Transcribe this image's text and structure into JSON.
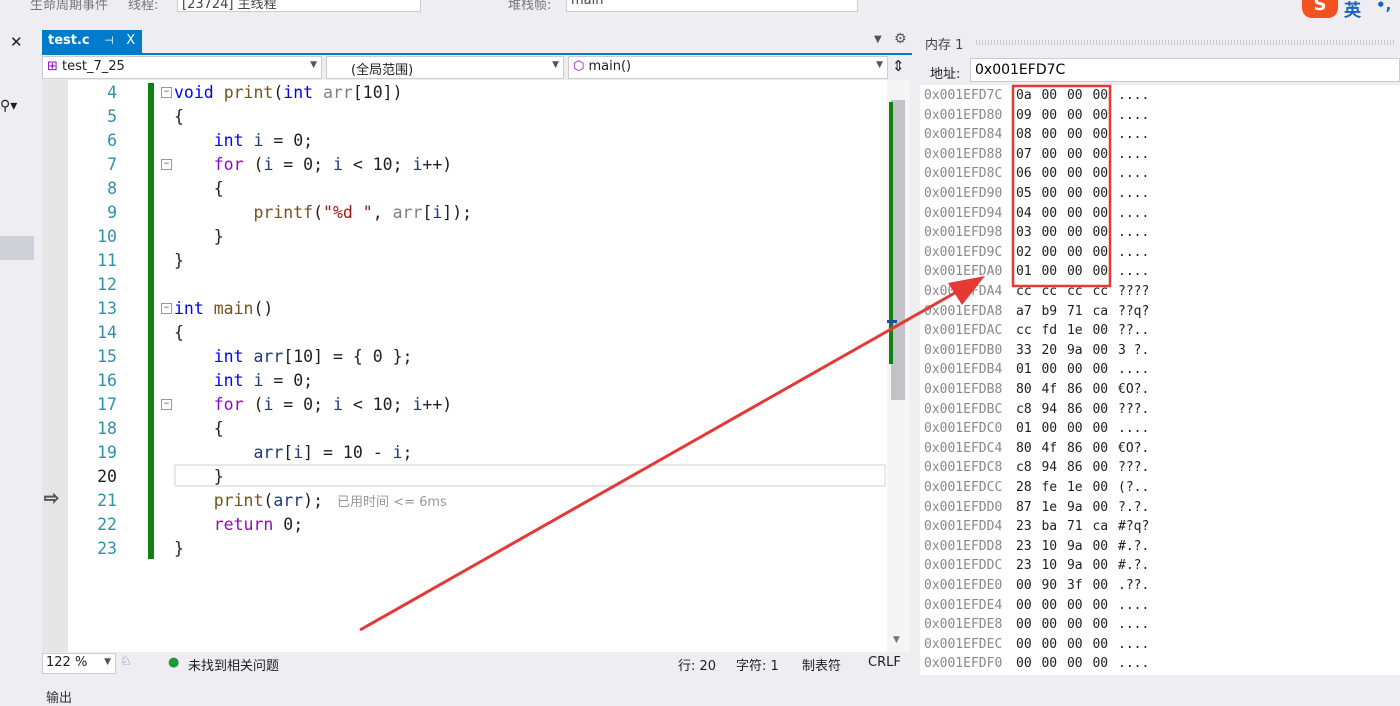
{
  "toolbar": {
    "lifecycle": "生命周期事件",
    "thread_label": "线程:",
    "thread_value": "[23724] 主线程",
    "stack_label": "堆栈帧:",
    "stack_value": "main"
  },
  "ime": {
    "mode": "英",
    "punct": "•,"
  },
  "editor": {
    "tab": {
      "name": "test.c",
      "pin": "⊣",
      "close": "X"
    },
    "nav": {
      "project": "test_7_25",
      "scope": "(全局范围)",
      "member": "main()"
    },
    "lines": [
      {
        "n": "4",
        "t": [
          [
            "void",
            "kw"
          ],
          [
            " ",
            "pl"
          ],
          [
            "print",
            "fn"
          ],
          [
            "(",
            "pl"
          ],
          [
            "int",
            "kw"
          ],
          [
            " ",
            "pl"
          ],
          [
            "arr",
            "var"
          ],
          [
            "[10])",
            "pl"
          ]
        ]
      },
      {
        "n": "5",
        "t": [
          [
            "{",
            "pl"
          ]
        ]
      },
      {
        "n": "6",
        "t": [
          [
            "    ",
            "pl"
          ],
          [
            "int",
            "kw"
          ],
          [
            " ",
            "pl"
          ],
          [
            "i",
            "loc"
          ],
          [
            " = 0;",
            "pl"
          ]
        ]
      },
      {
        "n": "7",
        "t": [
          [
            "    ",
            "pl"
          ],
          [
            "for",
            "ctl"
          ],
          [
            " (",
            "pl"
          ],
          [
            "i",
            "loc"
          ],
          [
            " = 0; ",
            "pl"
          ],
          [
            "i",
            "loc"
          ],
          [
            " < 10; ",
            "pl"
          ],
          [
            "i",
            "loc"
          ],
          [
            "++)",
            "pl"
          ]
        ]
      },
      {
        "n": "8",
        "t": [
          [
            "    {",
            "pl"
          ]
        ]
      },
      {
        "n": "9",
        "t": [
          [
            "        ",
            "pl"
          ],
          [
            "printf",
            "fn"
          ],
          [
            "(",
            "pl"
          ],
          [
            "\"%d \"",
            "str"
          ],
          [
            ", ",
            "pl"
          ],
          [
            "arr",
            "var"
          ],
          [
            "[",
            "pl"
          ],
          [
            "i",
            "loc"
          ],
          [
            "]);",
            "pl"
          ]
        ]
      },
      {
        "n": "10",
        "t": [
          [
            "    }",
            "pl"
          ]
        ]
      },
      {
        "n": "11",
        "t": [
          [
            "}",
            "pl"
          ]
        ]
      },
      {
        "n": "12",
        "t": []
      },
      {
        "n": "13",
        "t": [
          [
            "int",
            "kw"
          ],
          [
            " ",
            "pl"
          ],
          [
            "main",
            "fn"
          ],
          [
            "()",
            "pl"
          ]
        ]
      },
      {
        "n": "14",
        "t": [
          [
            "{",
            "pl"
          ]
        ]
      },
      {
        "n": "15",
        "t": [
          [
            "    ",
            "pl"
          ],
          [
            "int",
            "kw"
          ],
          [
            " ",
            "pl"
          ],
          [
            "arr",
            "loc"
          ],
          [
            "[10] = { 0 };",
            "pl"
          ]
        ]
      },
      {
        "n": "16",
        "t": [
          [
            "    ",
            "pl"
          ],
          [
            "int",
            "kw"
          ],
          [
            " ",
            "pl"
          ],
          [
            "i",
            "loc"
          ],
          [
            " = 0;",
            "pl"
          ]
        ]
      },
      {
        "n": "17",
        "t": [
          [
            "    ",
            "pl"
          ],
          [
            "for",
            "ctl"
          ],
          [
            " (",
            "pl"
          ],
          [
            "i",
            "loc"
          ],
          [
            " = 0; ",
            "pl"
          ],
          [
            "i",
            "loc"
          ],
          [
            " < 10; ",
            "pl"
          ],
          [
            "i",
            "loc"
          ],
          [
            "++)",
            "pl"
          ]
        ]
      },
      {
        "n": "18",
        "t": [
          [
            "    {",
            "pl"
          ]
        ]
      },
      {
        "n": "19",
        "t": [
          [
            "        ",
            "pl"
          ],
          [
            "arr",
            "loc"
          ],
          [
            "[",
            "pl"
          ],
          [
            "i",
            "loc"
          ],
          [
            "] = 10 - ",
            "pl"
          ],
          [
            "i",
            "loc"
          ],
          [
            ";",
            "pl"
          ]
        ]
      },
      {
        "n": "20",
        "t": [
          [
            "    }",
            "pl"
          ]
        ]
      },
      {
        "n": "21",
        "t": [
          [
            "    ",
            "pl"
          ],
          [
            "print",
            "fn"
          ],
          [
            "(",
            "pl"
          ],
          [
            "arr",
            "loc"
          ],
          [
            ");",
            "pl"
          ]
        ]
      },
      {
        "n": "22",
        "t": [
          [
            "    ",
            "pl"
          ],
          [
            "return",
            "ctl"
          ],
          [
            " 0;",
            "pl"
          ]
        ]
      },
      {
        "n": "23",
        "t": [
          [
            "}",
            "pl"
          ]
        ]
      }
    ],
    "perf_tip": "已用时间 <= 6ms",
    "current_line": "21"
  },
  "status": {
    "zoom": "122 %",
    "issues": "未找到相关问题",
    "line": "行: 20",
    "char": "字符: 1",
    "tabs": "制表符",
    "eol": "CRLF"
  },
  "memory": {
    "title": "内存 1",
    "address_label": "地址:",
    "address": "0x001EFD7C",
    "rows": [
      [
        "0x001EFD7C",
        "0a 00 00 00",
        "...."
      ],
      [
        "0x001EFD80",
        "09 00 00 00",
        "...."
      ],
      [
        "0x001EFD84",
        "08 00 00 00",
        "...."
      ],
      [
        "0x001EFD88",
        "07 00 00 00",
        "...."
      ],
      [
        "0x001EFD8C",
        "06 00 00 00",
        "...."
      ],
      [
        "0x001EFD90",
        "05 00 00 00",
        "...."
      ],
      [
        "0x001EFD94",
        "04 00 00 00",
        "...."
      ],
      [
        "0x001EFD98",
        "03 00 00 00",
        "...."
      ],
      [
        "0x001EFD9C",
        "02 00 00 00",
        "...."
      ],
      [
        "0x001EFDA0",
        "01 00 00 00",
        "...."
      ],
      [
        "0x001EFDA4",
        "cc cc cc cc",
        "????"
      ],
      [
        "0x001EFDA8",
        "a7 b9 71 ca",
        "??q?"
      ],
      [
        "0x001EFDAC",
        "cc fd 1e 00",
        "??.."
      ],
      [
        "0x001EFDB0",
        "33 20 9a 00",
        "3 ?."
      ],
      [
        "0x001EFDB4",
        "01 00 00 00",
        "...."
      ],
      [
        "0x001EFDB8",
        "80 4f 86 00",
        "€O?."
      ],
      [
        "0x001EFDBC",
        "c8 94 86 00",
        "???."
      ],
      [
        "0x001EFDC0",
        "01 00 00 00",
        "...."
      ],
      [
        "0x001EFDC4",
        "80 4f 86 00",
        "€O?."
      ],
      [
        "0x001EFDC8",
        "c8 94 86 00",
        "???."
      ],
      [
        "0x001EFDCC",
        "28 fe 1e 00",
        "(?.."
      ],
      [
        "0x001EFDD0",
        "87 1e 9a 00",
        "?.?."
      ],
      [
        "0x001EFDD4",
        "23 ba 71 ca",
        "#?q?"
      ],
      [
        "0x001EFDD8",
        "23 10 9a 00",
        "#.?."
      ],
      [
        "0x001EFDDC",
        "23 10 9a 00",
        "#.?."
      ],
      [
        "0x001EFDE0",
        "00 90 3f 00",
        ".??."
      ],
      [
        "0x001EFDE4",
        "00 00 00 00",
        "...."
      ],
      [
        "0x001EFDE8",
        "00 00 00 00",
        "...."
      ],
      [
        "0x001EFDEC",
        "00 00 00 00",
        "...."
      ],
      [
        "0x001EFDF0",
        "00 00 00 00",
        "...."
      ]
    ]
  },
  "output": {
    "title": "输出"
  },
  "annotation_color": "#e53935",
  "accent": "#007acc"
}
